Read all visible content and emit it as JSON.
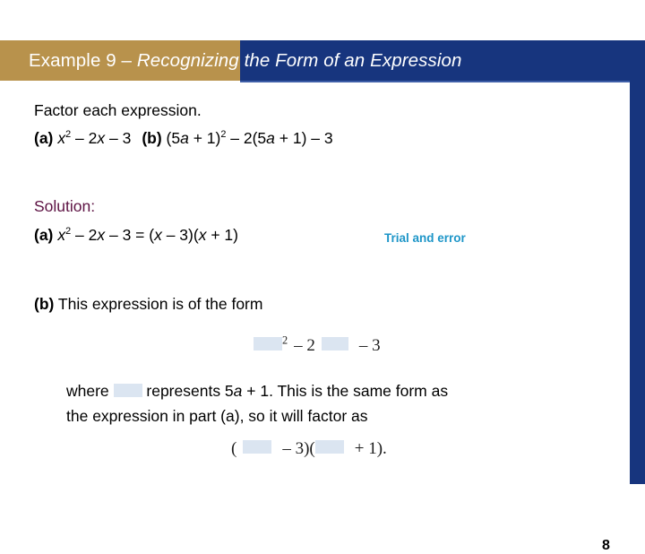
{
  "slide": {
    "page_number": "8",
    "colors": {
      "header_gold": "#b8924c",
      "header_blue": "#17357e",
      "solution_maroon": "#5d1243",
      "annotation_teal": "#1e96c8",
      "placeholder_box": "#dbe5f1"
    }
  },
  "header": {
    "label": "Example 9 – ",
    "title_italic": "Recognizing the Form of an Expression",
    "full_title": "Example 9 – Recognizing the Form of an Expression"
  },
  "body": {
    "instruction": "Factor each expression.",
    "parts_line": {
      "a_label": "(a)",
      "a_expr_pre": "x",
      "a_expr_sup": "2",
      "a_expr_post": " – 2x – 3",
      "b_label": "(b)",
      "b_expr_pre": "(5a + 1)",
      "b_expr_sup": "2",
      "b_expr_post": " – 2(5a + 1) – 3"
    },
    "solution_heading": "Solution:",
    "solution_a": {
      "label": "(a)",
      "expr_pre": "x",
      "expr_sup": "2",
      "expr_post": " – 2x – 3 = (x – 3)(x + 1)",
      "annotation": "Trial and error"
    },
    "solution_b": {
      "label": "(b)",
      "text": " This expression is of the form"
    },
    "form_expression": {
      "box1": "placeholder-box",
      "sup": "2",
      "mid": "– 2",
      "box2": "placeholder-box",
      "tail": "– 3",
      "plain": "□² – 2□ – 3"
    },
    "where_line_1_pre": "where ",
    "where_line_1_post": " represents 5a + 1. This is the same form as",
    "where_line_2": "the expression in part (a), so it will factor as",
    "final_expression": {
      "open": "(",
      "box1": "placeholder-box",
      "mid": "– 3)(",
      "box2": "placeholder-box",
      "tail": "+ 1).",
      "plain": "( □ – 3)( □ + 1)."
    }
  }
}
